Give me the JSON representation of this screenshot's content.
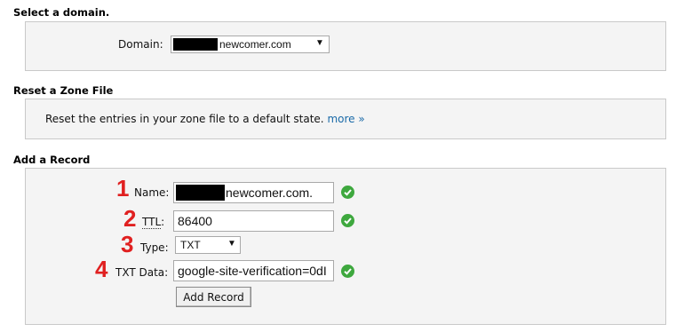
{
  "select_domain": {
    "heading": "Select a domain.",
    "label": "Domain:",
    "selected": "newcomer.com",
    "arrow": "▼"
  },
  "reset_zone": {
    "heading": "Reset a Zone File",
    "text": "Reset the entries in your zone file to a default state.",
    "link": "more »"
  },
  "add_record": {
    "heading": "Add a Record",
    "markers": [
      "1",
      "2",
      "3",
      "4"
    ],
    "name_label": "Name:",
    "name_value": "newcomer.com.",
    "ttl_label": "TTL",
    "ttl_colon": ":",
    "ttl_value": "86400",
    "type_label": "Type:",
    "type_value": "TXT",
    "type_arrow": "▼",
    "txt_label": "TXT Data:",
    "txt_value": "google-site-verification=0dI",
    "button": "Add Record"
  },
  "icons": {
    "valid": "check-circle-icon",
    "valid_color": "#3ea83e"
  }
}
